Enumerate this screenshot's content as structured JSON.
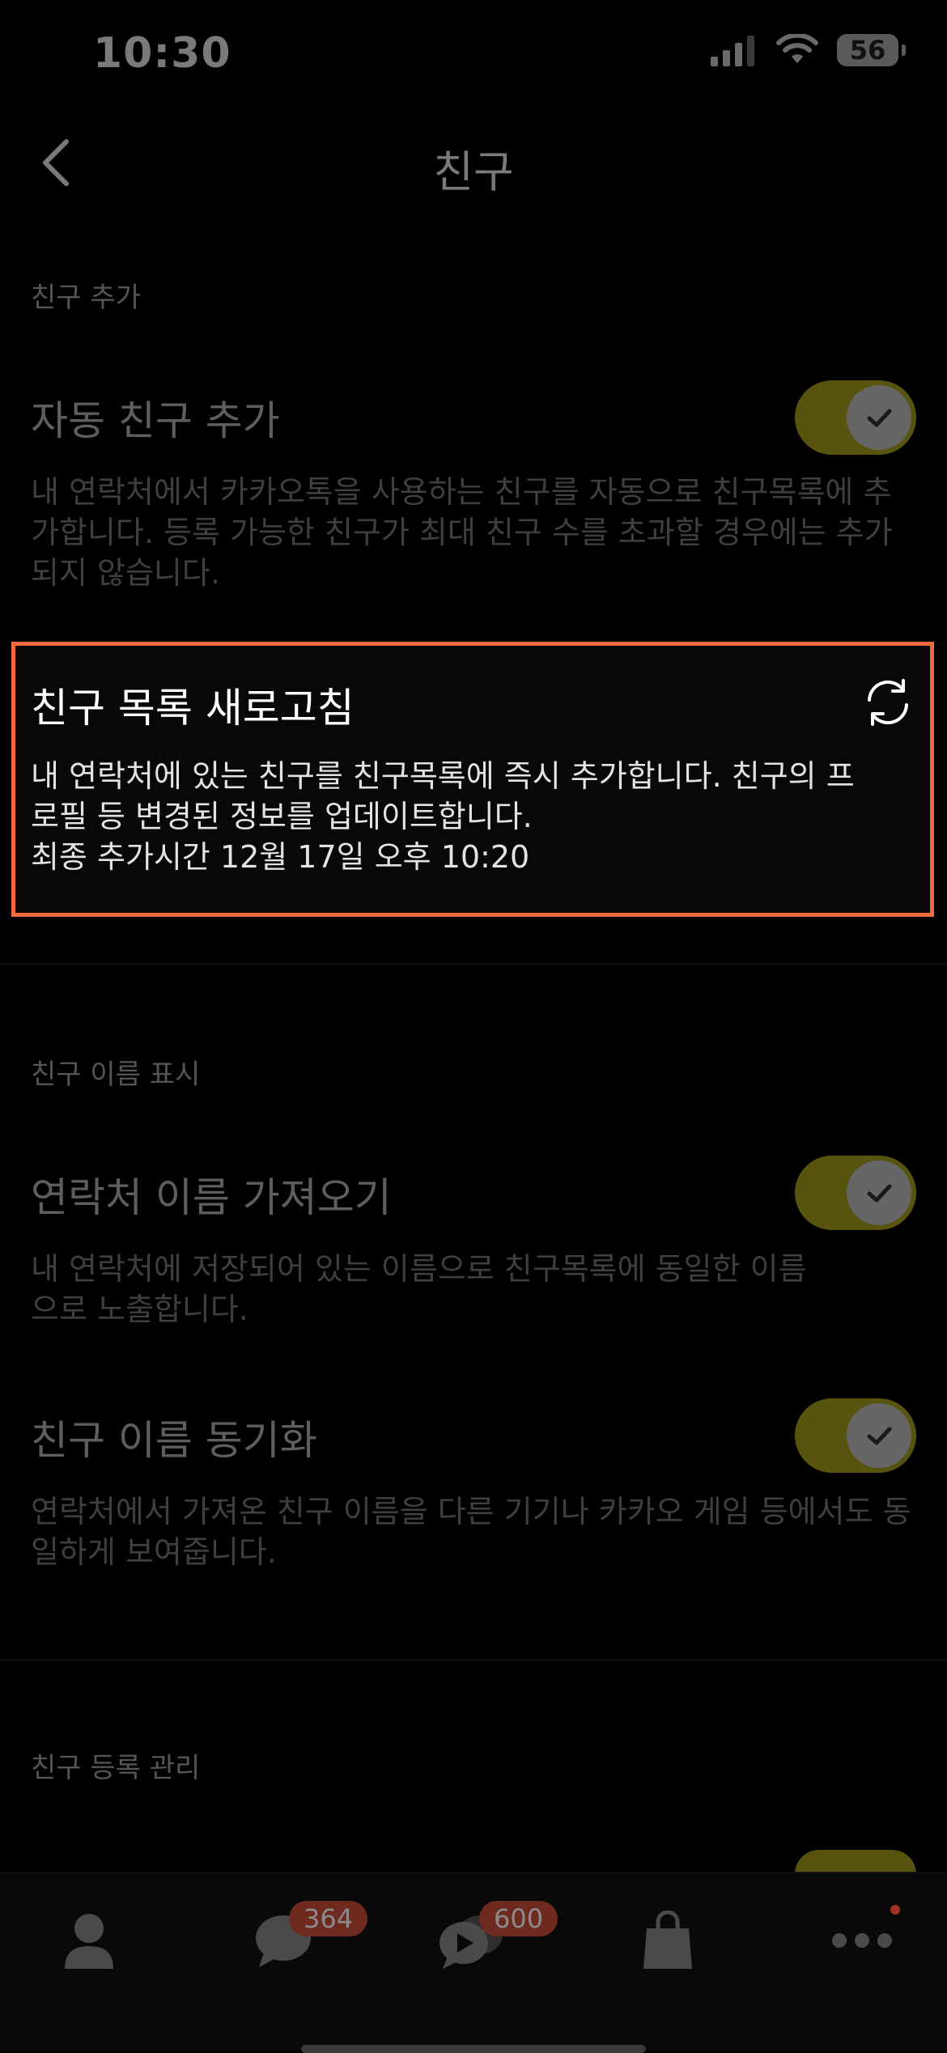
{
  "status": {
    "time": "10:30",
    "battery": "56"
  },
  "nav": {
    "title": "친구"
  },
  "sections": {
    "add_label": "친구 추가",
    "name_label": "친구 이름 표시",
    "manage_label": "친구 등록 관리"
  },
  "auto_add": {
    "title": "자동 친구 추가",
    "desc": "내 연락처에서 카카오톡을 사용하는 친구를 자동으로 친구목록에 추가합니다. 등록 가능한 친구가 최대 친구 수를 초과할 경우에는 추가되지 않습니다.",
    "enabled": true
  },
  "refresh": {
    "title": "친구 목록 새로고침",
    "desc_line1": "내 연락처에 있는 친구를 친구목록에 즉시 추가합니다. 친구의 프로필 등 변경된 정보를 업데이트합니다.",
    "desc_line2": "최종 추가시간 12월 17일 오후 10:20",
    "icon": "refresh-icon"
  },
  "import_names": {
    "title": "연락처 이름 가져오기",
    "desc": "내 연락처에 저장되어 있는 이름으로 친구목록에 동일한 이름으로 노출합니다.",
    "enabled": true
  },
  "sync_names": {
    "title": "친구 이름 동기화",
    "desc": "연락처에서 가져온 친구 이름을 다른 기기나 카카오 게임 등에서도 동일하게 보여줍니다.",
    "enabled": true
  },
  "tabbar": {
    "tabs": [
      {
        "icon": "person-icon"
      },
      {
        "icon": "chat-icon",
        "badge": "364"
      },
      {
        "icon": "openchat-icon",
        "badge": "600"
      },
      {
        "icon": "shopping-bag-icon"
      },
      {
        "icon": "more-icon"
      }
    ]
  },
  "colors": {
    "accent": "#f26a3d",
    "toggle": "#58540f"
  }
}
